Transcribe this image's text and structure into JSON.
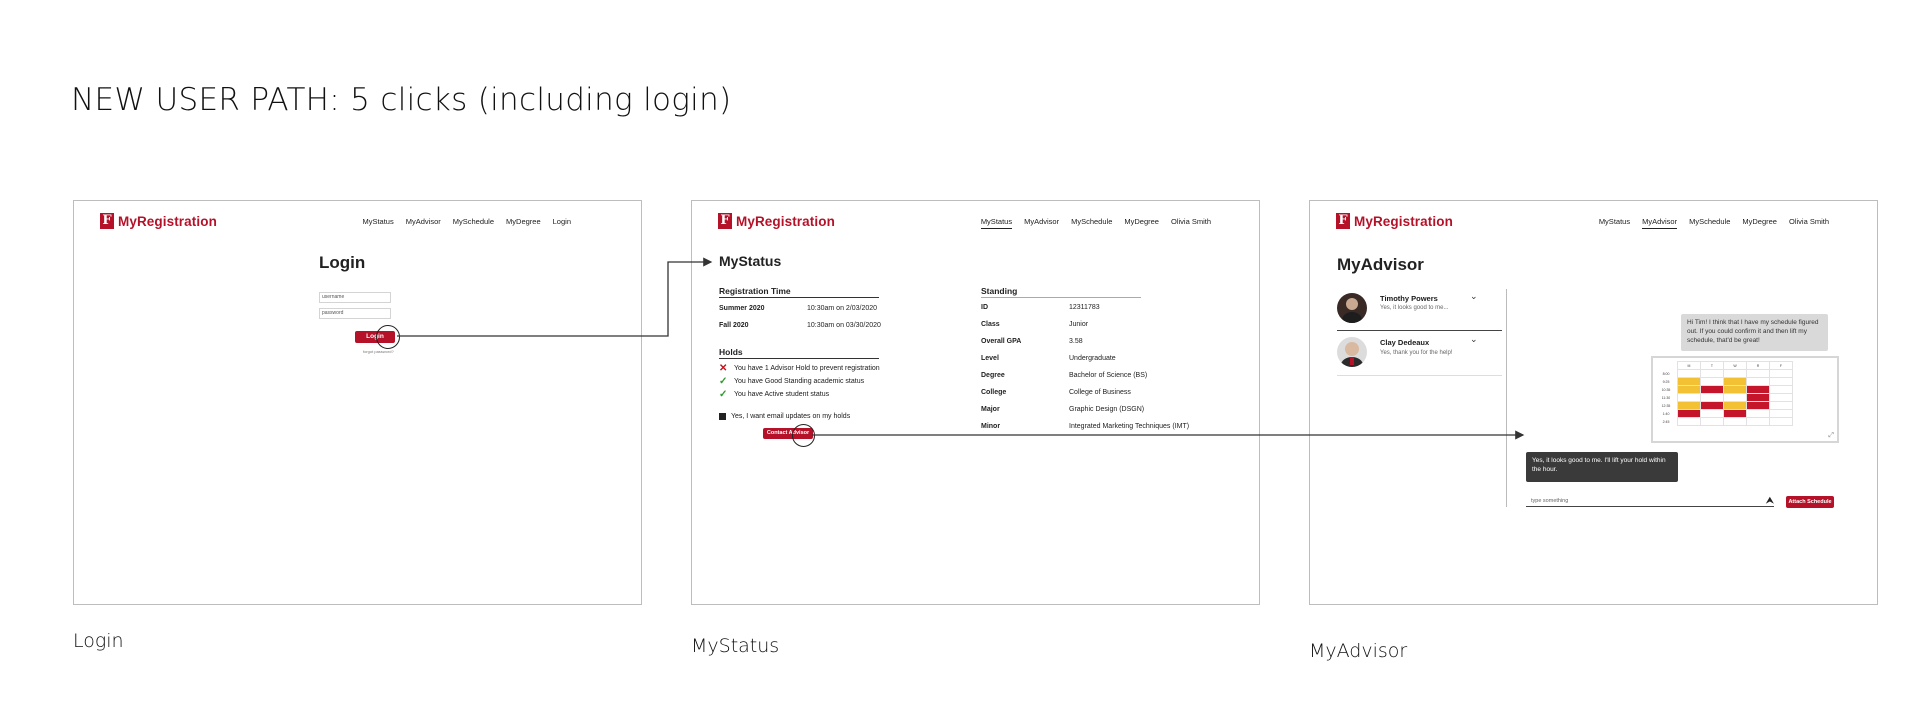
{
  "headline": "NEW USER PATH: 5 clicks (including login)",
  "captions": {
    "login": "Login",
    "mystatus": "MyStatus",
    "myadvisor": "MyAdvisor"
  },
  "brand": {
    "mark": "F",
    "name": "MyRegistration",
    "color": "#b5122a"
  },
  "login_screen": {
    "nav": [
      "MyStatus",
      "MyAdvisor",
      "MySchedule",
      "MyDegree",
      "Login"
    ],
    "title": "Login",
    "username_placeholder": "username",
    "password_placeholder": "password",
    "button": "Login",
    "forgot": "forgot password?"
  },
  "status_screen": {
    "nav": [
      "MyStatus",
      "MyAdvisor",
      "MySchedule",
      "MyDegree",
      "Olivia Smith"
    ],
    "title": "MyStatus",
    "registration_heading": "Registration Time",
    "registration": [
      {
        "term": "Summer 2020",
        "time": "10:30am on 2/03/2020"
      },
      {
        "term": "Fall 2020",
        "time": "10:30am on 03/30/2020"
      }
    ],
    "holds_heading": "Holds",
    "holds": [
      {
        "status": "x",
        "text": "You have 1 Advisor Hold to prevent registration"
      },
      {
        "status": "check",
        "text": "You have Good Standing academic status"
      },
      {
        "status": "check",
        "text": "You have Active student status"
      }
    ],
    "email_checkbox": "Yes, I want email updates on my holds",
    "contact_button": "Contact Advisor",
    "standing_heading": "Standing",
    "standing": [
      {
        "k": "ID",
        "v": "12311783"
      },
      {
        "k": "Class",
        "v": "Junior"
      },
      {
        "k": "Overall GPA",
        "v": "3.58"
      },
      {
        "k": "Level",
        "v": "Undergraduate"
      },
      {
        "k": "Degree",
        "v": "Bachelor of Science (BS)"
      },
      {
        "k": "College",
        "v": "College of Business"
      },
      {
        "k": "Major",
        "v": "Graphic Design (DSGN)"
      },
      {
        "k": "Minor",
        "v": "Integrated Marketing Techniques (IMT)"
      }
    ]
  },
  "advisor_screen": {
    "nav": [
      "MyStatus",
      "MyAdvisor",
      "MySchedule",
      "MyDegree",
      "Olivia Smith"
    ],
    "title": "MyAdvisor",
    "contacts": [
      {
        "name": "Timothy Powers",
        "preview": "Yes, it looks good to me..."
      },
      {
        "name": "Clay Dedeaux",
        "preview": "Yes, thank you for the help!"
      }
    ],
    "student_message": "Hi Tim! I think that I have my schedule figured out. If you could confirm it and then lift my schedule, that'd be great!",
    "advisor_reply": "Yes, it looks good to me. I'll lift your hold within the hour.",
    "input_placeholder": "type something",
    "attach_button": "Attach Schedule",
    "schedule_days": [
      "M",
      "T",
      "W",
      "R",
      "F"
    ],
    "schedule_times": [
      "8:00",
      "9:25",
      "10:35",
      "11:30",
      "12:35",
      "1:40",
      "2:45"
    ]
  }
}
